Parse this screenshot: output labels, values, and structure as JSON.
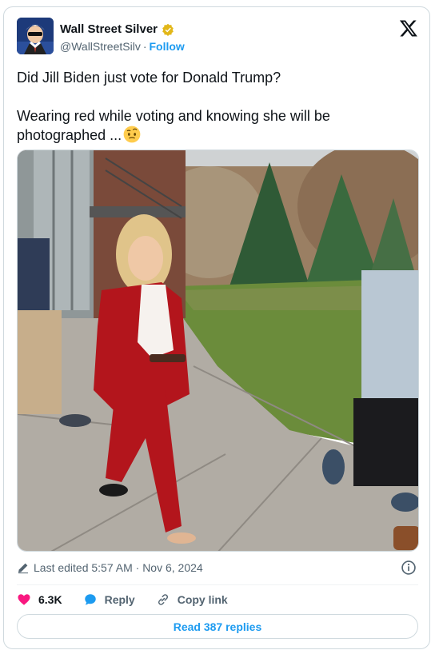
{
  "author": {
    "name": "Wall Street Silver",
    "handle": "@WallStreetSilv",
    "separator": "·",
    "follow_label": "Follow",
    "verified_badge_color": "#e2b719"
  },
  "tweet": {
    "line1": "Did Jill Biden just vote for Donald Trump?",
    "line2": "Wearing red while voting and knowing she will be\nphotographed ...",
    "emoji": "face-with-raised-eyebrow-emoji"
  },
  "meta": {
    "edited_text": "Last edited 5:57 AM · Nov 6, 2024"
  },
  "actions": {
    "likes_count": "6.3K",
    "reply_label": "Reply",
    "copy_link_label": "Copy link",
    "like_color": "#f91880",
    "reply_color": "#1d9bf0"
  },
  "read_replies_label": "Read 387 replies",
  "colors": {
    "accent": "#1d9bf0",
    "muted": "#536471"
  }
}
